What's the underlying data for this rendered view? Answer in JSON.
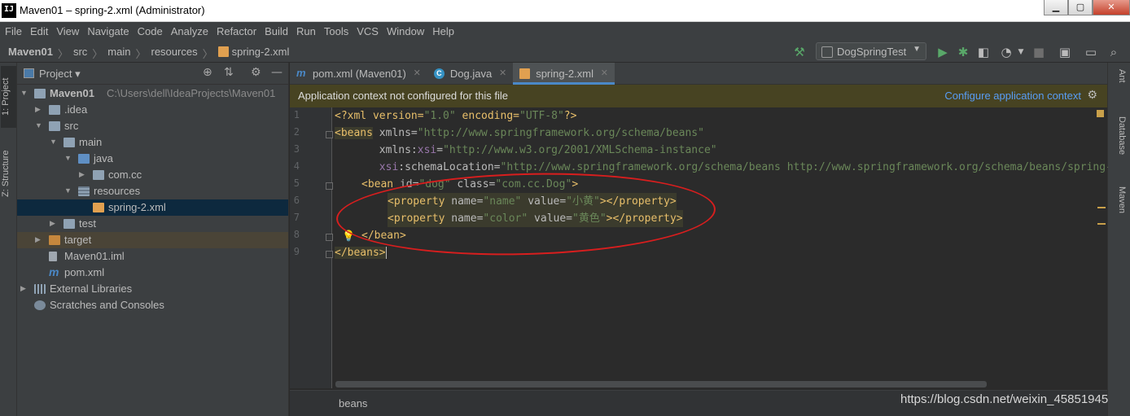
{
  "window": {
    "title": "Maven01 – spring-2.xml (Administrator)",
    "app_icon": "IJ"
  },
  "menu": [
    "File",
    "Edit",
    "View",
    "Navigate",
    "Code",
    "Analyze",
    "Refactor",
    "Build",
    "Run",
    "Tools",
    "VCS",
    "Window",
    "Help"
  ],
  "breadcrumb": {
    "project": "Maven01",
    "items": [
      "src",
      "main",
      "resources",
      "spring-2.xml"
    ]
  },
  "run_config": "DogSpringTest",
  "left_tabs": {
    "project": "1: Project",
    "structure": "Z: Structure"
  },
  "right_tabs": {
    "ant": "Ant",
    "database": "Database",
    "maven": "Maven"
  },
  "project_panel": {
    "title": "Project",
    "tree": [
      {
        "label": "Maven01",
        "path": "C:\\Users\\dell\\IdeaProjects\\Maven01",
        "depth": 0,
        "arrow": "▼",
        "icon": "folder-icon"
      },
      {
        "label": ".idea",
        "depth": 1,
        "arrow": "▶",
        "icon": "folder-icon"
      },
      {
        "label": "src",
        "depth": 1,
        "arrow": "▼",
        "icon": "folder-icon"
      },
      {
        "label": "main",
        "depth": 2,
        "arrow": "▼",
        "icon": "folder-icon"
      },
      {
        "label": "java",
        "depth": 3,
        "arrow": "▼",
        "icon": "source-folder-icon"
      },
      {
        "label": "com.cc",
        "depth": 4,
        "arrow": "▶",
        "icon": "package-icon"
      },
      {
        "label": "resources",
        "depth": 3,
        "arrow": "▼",
        "icon": "resources-folder-icon"
      },
      {
        "label": "spring-2.xml",
        "depth": 4,
        "arrow": "",
        "icon": "spring-xml-icon",
        "selected": true
      },
      {
        "label": "test",
        "depth": 2,
        "arrow": "▶",
        "icon": "folder-icon"
      },
      {
        "label": "target",
        "depth": 1,
        "arrow": "▶",
        "icon": "excluded-folder-icon",
        "highlight": true
      },
      {
        "label": "Maven01.iml",
        "depth": 1,
        "arrow": "",
        "icon": "iml-file-icon"
      },
      {
        "label": "pom.xml",
        "depth": 1,
        "arrow": "",
        "icon": "maven-file-icon"
      },
      {
        "label": "External Libraries",
        "depth": 0,
        "arrow": "▶",
        "icon": "libraries-icon"
      },
      {
        "label": "Scratches and Consoles",
        "depth": 0,
        "arrow": "",
        "icon": "scratches-icon"
      }
    ]
  },
  "tabs": [
    {
      "label": "pom.xml (Maven01)",
      "icon": "maven-icon",
      "active": false
    },
    {
      "label": "Dog.java",
      "icon": "class-icon",
      "active": false
    },
    {
      "label": "spring-2.xml",
      "icon": "spring-xml-icon",
      "active": true
    }
  ],
  "banner": {
    "message": "Application context not configured for this file",
    "action": "Configure application context"
  },
  "code_lines": [
    {
      "n": "1"
    },
    {
      "n": "2"
    },
    {
      "n": "3"
    },
    {
      "n": "4"
    },
    {
      "n": "5"
    },
    {
      "n": "6"
    },
    {
      "n": "7"
    },
    {
      "n": "8"
    },
    {
      "n": "9"
    }
  ],
  "code": {
    "l1": {
      "a": "<?xml version=",
      "b": "\"1.0\"",
      "c": " encoding=",
      "d": "\"UTF-8\"",
      "e": "?>"
    },
    "l2": {
      "tag": "<beans",
      "attr": " xmlns=",
      "val": "\"http://www.springframework.org/schema/beans\""
    },
    "l3": {
      "pre": "       xmlns:",
      "ns": "xsi",
      "eq": "=",
      "val": "\"http://www.w3.org/2001/XMLSchema-instance\""
    },
    "l4": {
      "pre": "       ",
      "ns": "xsi",
      "attr": ":schemaLocation=",
      "val": "\"http://www.springframework.org/schema/beans http://www.springframework.org/schema/beans/spring-beans.xsd\""
    },
    "l5": {
      "tag": "<bean",
      "a1": " id=",
      "v1": "\"dog\"",
      "a2": " class=",
      "v2": "\"com.cc.Dog\"",
      "end": ">"
    },
    "l6": {
      "tag": "<property",
      "a1": " name=",
      "v1": "\"name\"",
      "a2": " value=",
      "v2": "\"小黄\"",
      "end": "></property>"
    },
    "l7": {
      "tag": "<property",
      "a1": " name=",
      "v1": "\"color\"",
      "a2": " value=",
      "v2": "\"黄色\"",
      "end": "></property>"
    },
    "l8": {
      "tag": "</bean>"
    },
    "l9": {
      "tag": "</beans>"
    }
  },
  "status_breadcrumb": "beans",
  "watermark": "https://blog.csdn.net/weixin_45851945"
}
